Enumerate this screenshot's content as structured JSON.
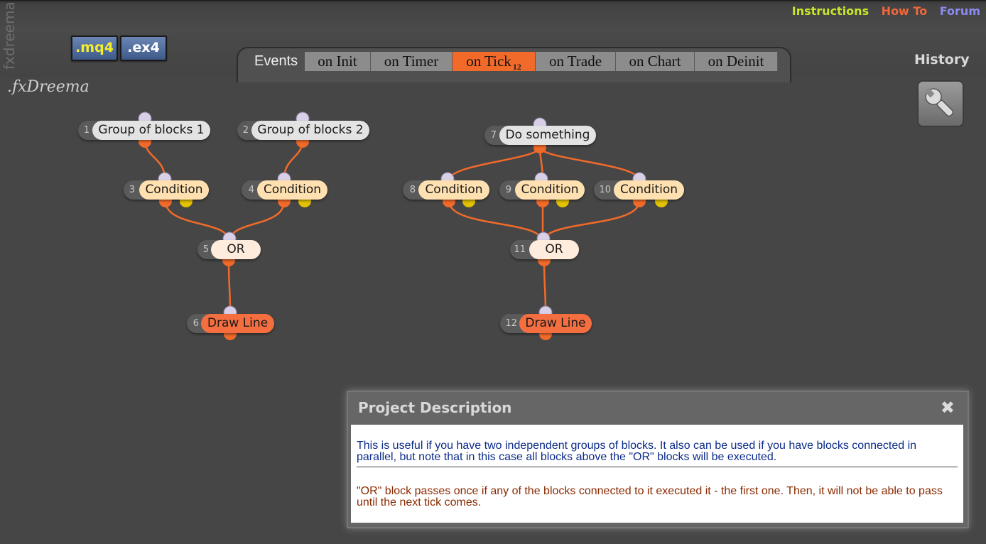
{
  "sidebar_logo": "fxdreema",
  "brand": ".fxDreema",
  "file_buttons": {
    "mq4": ".mq4",
    "ex4": ".ex4"
  },
  "top_links": [
    {
      "label": "Instructions",
      "color": "#c8e62a"
    },
    {
      "label": "How To",
      "color": "#f2683a"
    },
    {
      "label": "Forum",
      "color": "#8a8af0"
    }
  ],
  "events": {
    "label": "Events",
    "tabs": [
      {
        "label": "on Init"
      },
      {
        "label": "on Timer"
      },
      {
        "label": "on Tick",
        "badge": "12",
        "active": true
      },
      {
        "label": "on Trade"
      },
      {
        "label": "on Chart"
      },
      {
        "label": "on Deinit"
      }
    ]
  },
  "history": "History",
  "tools_icon": "wrench-icon",
  "blocks": [
    {
      "id": "1",
      "label": "Group of blocks 1",
      "kind": "grey"
    },
    {
      "id": "2",
      "label": "Group of blocks 2",
      "kind": "grey"
    },
    {
      "id": "3",
      "label": "Condition",
      "kind": "condition"
    },
    {
      "id": "4",
      "label": "Condition",
      "kind": "condition"
    },
    {
      "id": "5",
      "label": "OR",
      "kind": "or"
    },
    {
      "id": "6",
      "label": "Draw Line",
      "kind": "draw"
    },
    {
      "id": "7",
      "label": "Do something",
      "kind": "grey"
    },
    {
      "id": "8",
      "label": "Condition",
      "kind": "condition"
    },
    {
      "id": "9",
      "label": "Condition",
      "kind": "condition"
    },
    {
      "id": "10",
      "label": "Condition",
      "kind": "condition"
    },
    {
      "id": "11",
      "label": "OR",
      "kind": "or"
    },
    {
      "id": "12",
      "label": "Draw Line",
      "kind": "draw"
    }
  ],
  "connections": [
    [
      "1",
      "3"
    ],
    [
      "2",
      "4"
    ],
    [
      "3",
      "5"
    ],
    [
      "4",
      "5"
    ],
    [
      "5",
      "6"
    ],
    [
      "7",
      "8"
    ],
    [
      "7",
      "9"
    ],
    [
      "7",
      "10"
    ],
    [
      "8",
      "11"
    ],
    [
      "9",
      "11"
    ],
    [
      "10",
      "11"
    ],
    [
      "11",
      "12"
    ]
  ],
  "colors": {
    "wire_orange": "#f26a2a",
    "wire_pink": "#f5d0d6",
    "accent": "#f26a2a"
  },
  "dialog": {
    "title": "Project Description",
    "close_icon": "close-icon",
    "paragraph1": "This is useful if you have two independent groups of blocks. It also can be used if you have blocks connected in parallel, but note that in this case all blocks above the \"OR\" blocks will be executed.",
    "paragraph2": "\"OR\" block passes once if any of the blocks connected to it executed it - the first one. Then, it will not be able to pass until the next tick comes."
  }
}
